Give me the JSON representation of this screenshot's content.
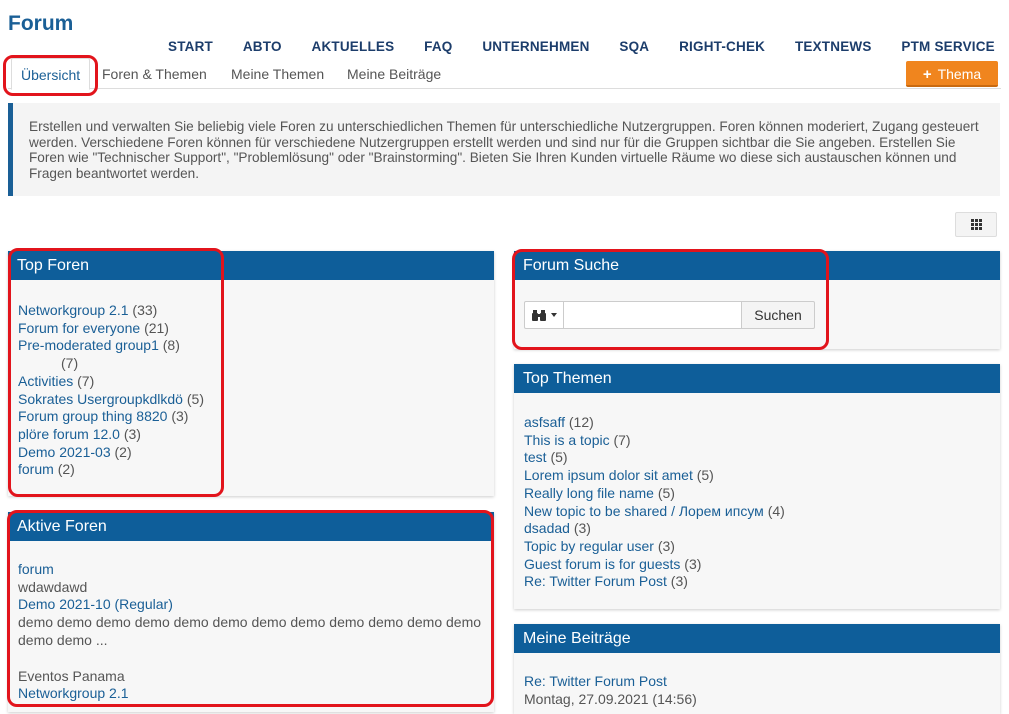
{
  "page": {
    "title": "Forum"
  },
  "topnav": [
    "START",
    "ABTO",
    "AKTUELLES",
    "FAQ",
    "UNTERNEHMEN",
    "SQA",
    "RIGHT-CHEK",
    "TEXTNEWS",
    "PTM SERVICE"
  ],
  "tabs": [
    "Übersicht",
    "Foren & Themen",
    "Meine Themen",
    "Meine Beiträge"
  ],
  "new_topic_button": {
    "label": "Thema",
    "icon": "plus-icon"
  },
  "info_text": "Erstellen und verwalten Sie beliebig viele Foren zu unterschiedlichen Themen für unterschiedliche Nutzergruppen. Foren können moderiert, Zugang gesteuert werden. Verschiedene Foren können für verschiedene Nutzergruppen erstellt werden und sind nur für die Gruppen sichtbar die Sie angeben. Erstellen Sie Foren wie \"Technischer Support\", \"Problemlösung\" oder \"Brainstorming\". Bieten Sie Ihren Kunden virtuelle Räume wo diese sich austauschen können und Fragen beantwortet werden.",
  "grid_toggle": {
    "icon": "grid-icon"
  },
  "top_foren": {
    "title": "Top Foren",
    "items": [
      {
        "name": "Networkgroup 2.1",
        "count": "(33)"
      },
      {
        "name": "Forum for everyone",
        "count": "(21)"
      },
      {
        "name": "Pre-moderated group1",
        "count": "(8)"
      },
      {
        "name": "",
        "count": "(7)"
      },
      {
        "name": "Activities",
        "count": "(7)"
      },
      {
        "name": "Sokrates Usergroupkdlkdö",
        "count": "(5)"
      },
      {
        "name": "Forum group thing 8820",
        "count": "(3)"
      },
      {
        "name": "plöre forum 12.0",
        "count": "(3)"
      },
      {
        "name": "Demo 2021-03",
        "count": "(2)"
      },
      {
        "name": "forum",
        "count": "(2)"
      }
    ]
  },
  "aktive_foren": {
    "title": "Aktive Foren",
    "items": [
      {
        "name": "forum",
        "desc": "wdawdawd"
      },
      {
        "name": "Demo 2021-10 (Regular)",
        "desc": "demo demo demo demo demo demo demo demo demo demo demo demo demo demo ..."
      },
      {
        "name": "",
        "desc": "Eventos Panama"
      },
      {
        "name": "Networkgroup 2.1",
        "desc": ""
      }
    ]
  },
  "forum_suche": {
    "title": "Forum Suche",
    "button": "Suchen",
    "dropdown_icon": "binoculars-icon",
    "value": ""
  },
  "top_themen": {
    "title": "Top Themen",
    "items": [
      {
        "name": "asfsaff",
        "count": "(12)"
      },
      {
        "name": "This is a topic",
        "count": "(7)"
      },
      {
        "name": "test",
        "count": "(5)"
      },
      {
        "name": "Lorem ipsum dolor sit amet",
        "count": "(5)"
      },
      {
        "name": "Really long file name",
        "count": "(5)"
      },
      {
        "name": "New topic to be shared / Лорем ипсум",
        "count": "(4)"
      },
      {
        "name": "dsadad",
        "count": "(3)"
      },
      {
        "name": "Topic by regular user",
        "count": "(3)"
      },
      {
        "name": "Guest forum is for guests",
        "count": "(3)"
      },
      {
        "name": "Re: Twitter Forum Post",
        "count": "(3)"
      }
    ]
  },
  "meine_beitraege": {
    "title": "Meine Beiträge",
    "items": [
      {
        "name": "Re: Twitter Forum Post",
        "date": "Montag, 27.09.2021 (14:56)"
      }
    ]
  },
  "colors": {
    "brand": "#1a5f96",
    "panel_header": "#0e5e9a",
    "accent": "#f0851e",
    "annotation": "#e2141c"
  }
}
